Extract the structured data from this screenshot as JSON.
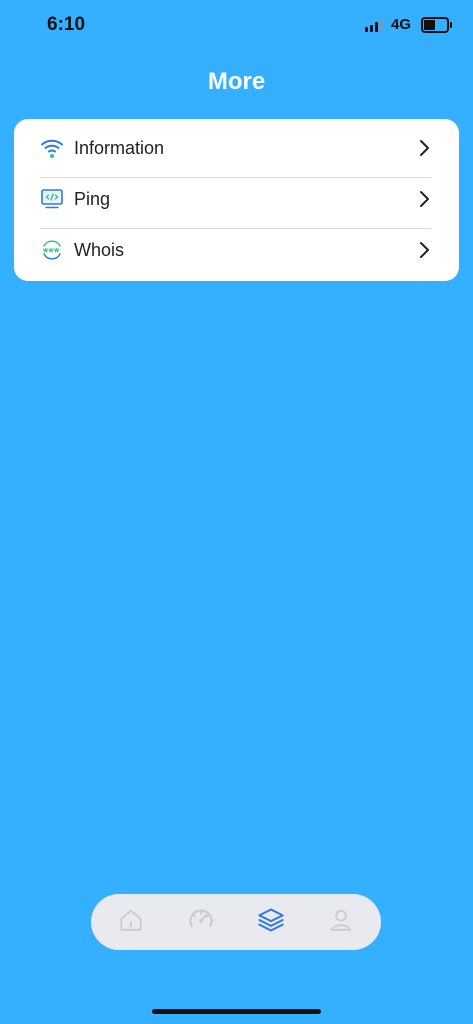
{
  "status_bar": {
    "time": "6:10",
    "network": "4G",
    "battery_level": 0.55
  },
  "header": {
    "title": "More"
  },
  "menu": {
    "items": [
      {
        "icon": "wifi-icon",
        "label": "Information"
      },
      {
        "icon": "code-monitor-icon",
        "label": "Ping"
      },
      {
        "icon": "www-globe-icon",
        "label": "Whois"
      }
    ]
  },
  "tab_bar": {
    "tabs": [
      {
        "icon": "home-icon",
        "active": false
      },
      {
        "icon": "speedometer-icon",
        "active": false
      },
      {
        "icon": "layers-icon",
        "active": true
      },
      {
        "icon": "user-icon",
        "active": false
      }
    ]
  },
  "colors": {
    "background": "#35afff",
    "card": "#ffffff",
    "tab_bar": "#e9eaef",
    "active_tab": "#2f78e0",
    "inactive_tab": "#c9cbd2",
    "accent_green": "#36c77b"
  }
}
